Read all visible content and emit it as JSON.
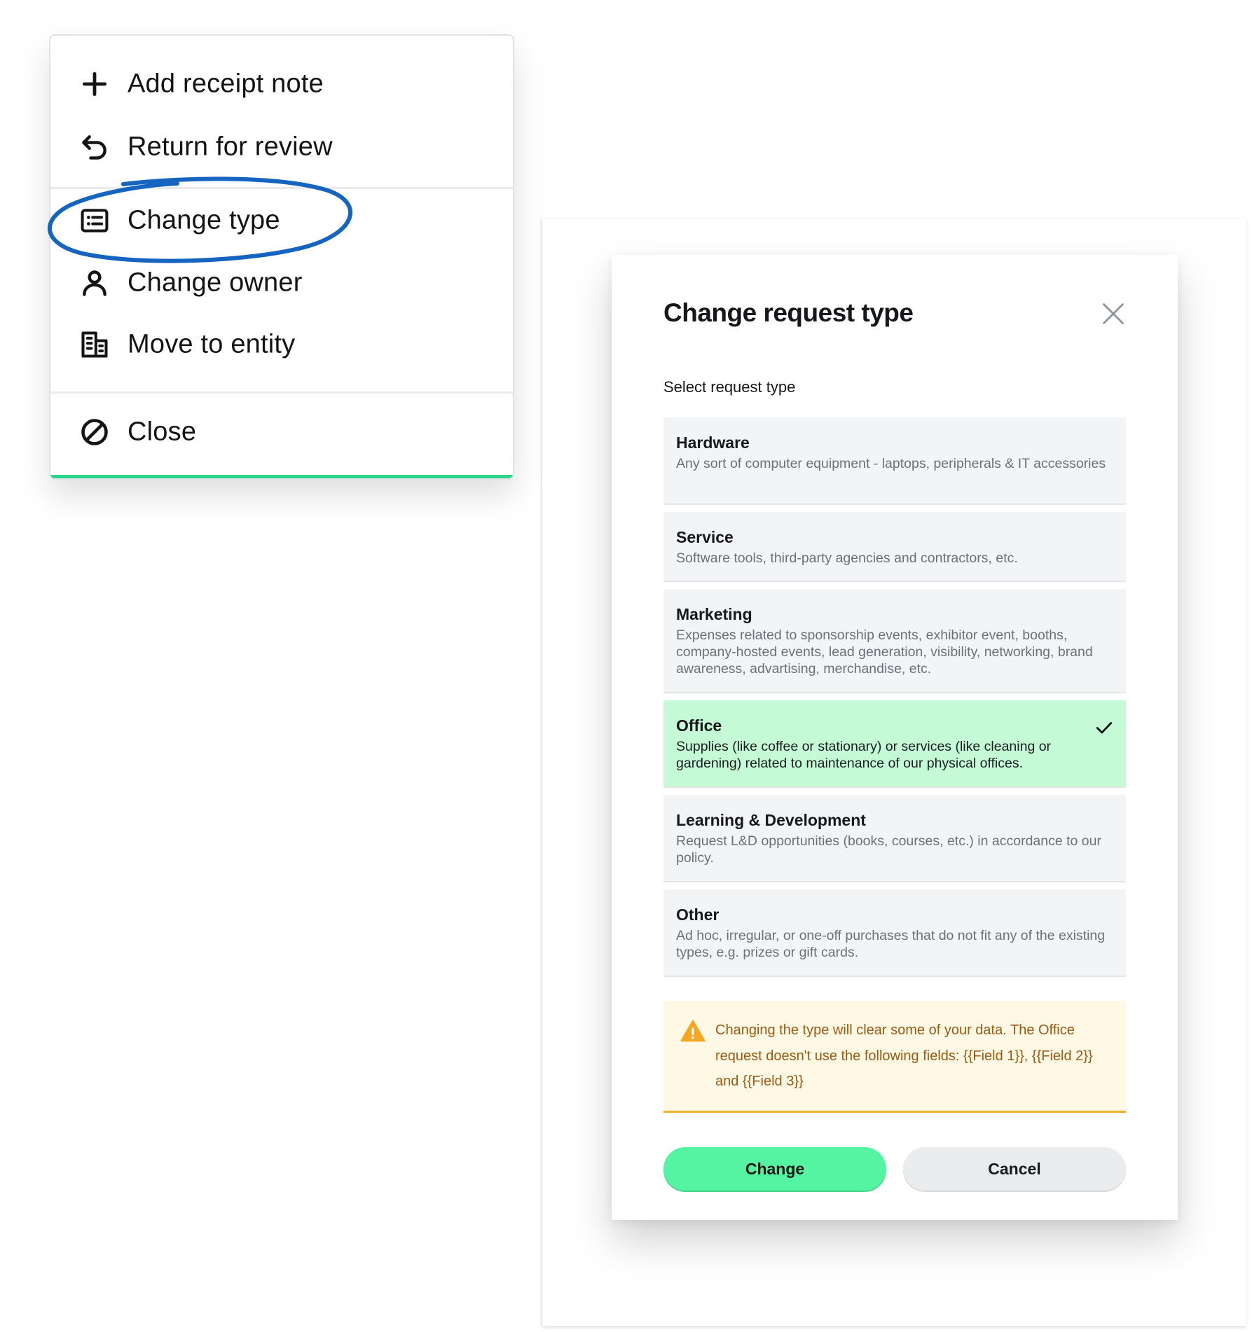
{
  "menu": {
    "items": [
      {
        "label": "Add receipt note",
        "icon": "plus-icon"
      },
      {
        "label": "Return for review",
        "icon": "return-arrow-icon"
      },
      {
        "label": "Change type",
        "icon": "list-card-icon",
        "highlighted": true
      },
      {
        "label": "Change owner",
        "icon": "person-icon"
      },
      {
        "label": "Move to entity",
        "icon": "building-icon"
      },
      {
        "label": "Close",
        "icon": "ban-icon"
      }
    ],
    "accent_color": "#2ed48c",
    "annotation_color": "#1565c0"
  },
  "modal": {
    "title": "Change request type",
    "select_label": "Select request type",
    "options": [
      {
        "title": "Hardware",
        "description": "Any sort of computer equipment - laptops, peripherals & IT accessories",
        "selected": false
      },
      {
        "title": "Service",
        "description": "Software tools, third-party agencies and contractors, etc.",
        "selected": false
      },
      {
        "title": "Marketing",
        "description": "Expenses related to sponsorship events, exhibitor event, booths, company-hosted events, lead generation, visibility, networking, brand awareness, advartising, merchandise, etc.",
        "selected": false
      },
      {
        "title": "Office",
        "description": "Supplies (like coffee or stationary) or services (like cleaning or gardening) related to maintenance of our physical offices.",
        "selected": true
      },
      {
        "title": "Learning & Development",
        "description": "Request L&D opportunities (books, courses, etc.) in accordance to our policy.",
        "selected": false
      },
      {
        "title": "Other",
        "description": "Ad hoc, irregular, or one-off purchases that do not fit any of the existing types, e.g. prizes or gift cards.",
        "selected": false
      }
    ],
    "warning": "Changing the type will clear some of your data. The Office request doesn't use the following fields: {{Field 1}}, {{Field 2}} and {{Field 3}}",
    "change_label": "Change",
    "cancel_label": "Cancel",
    "colors": {
      "selected_bg": "#c5fad7",
      "primary_button": "#55f4a2",
      "warning_bg": "#fef8e4",
      "warning_border": "#f6ae2d",
      "warning_text": "#9b5a12"
    }
  }
}
